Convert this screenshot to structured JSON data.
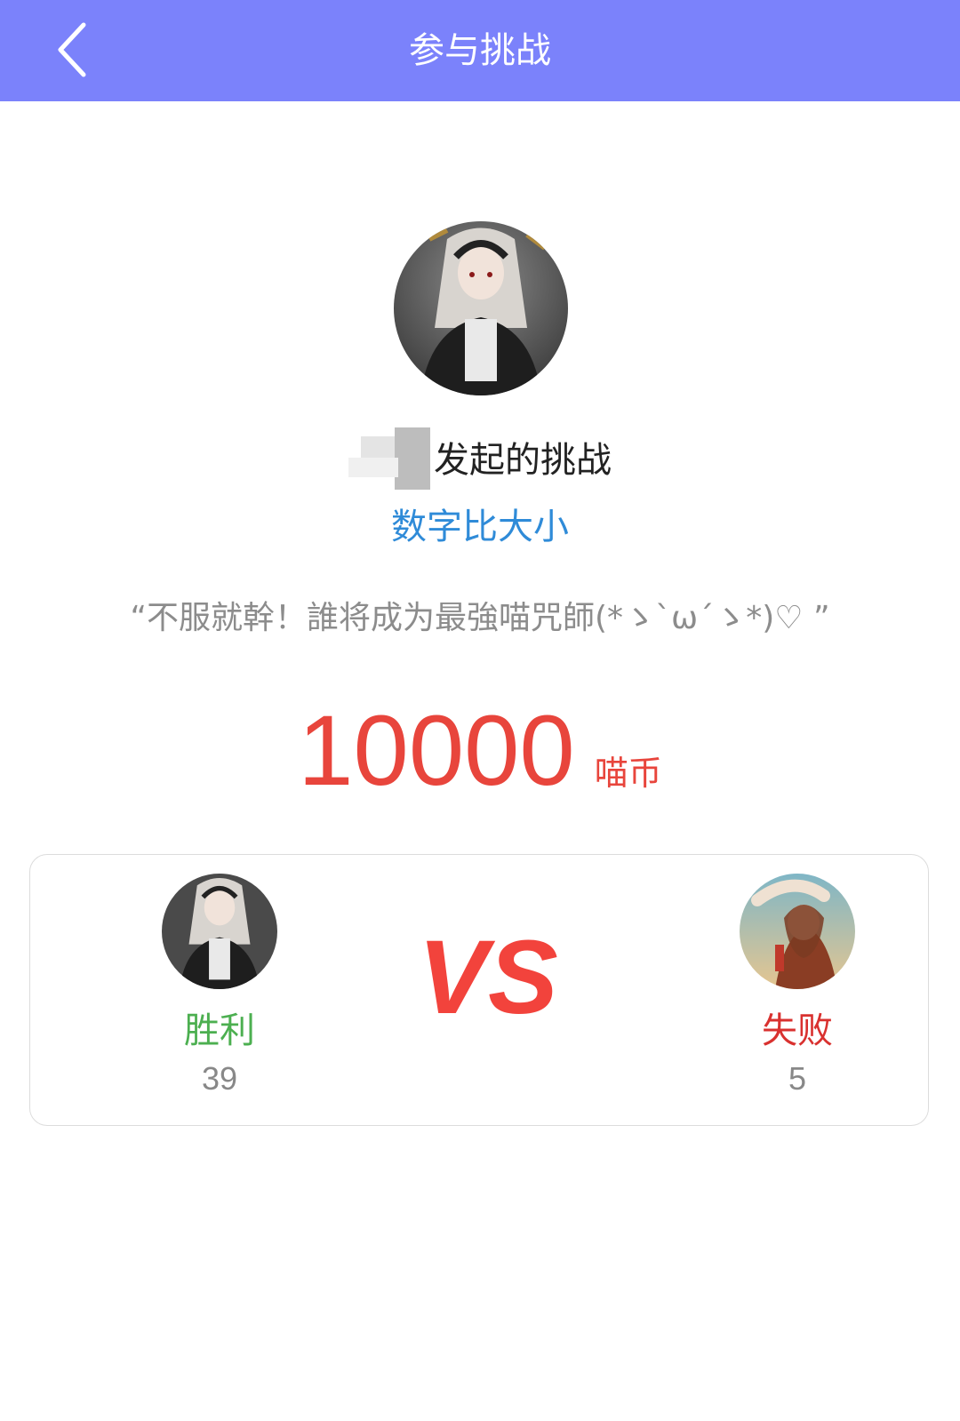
{
  "header": {
    "title": "参与挑战",
    "back_icon": "chevron-left-icon"
  },
  "challenge": {
    "initiator_suffix": "发起的挑战",
    "game_type": "数字比大小",
    "slogan": "“不服就幹！誰将成为最強喵咒師(*ゝ`ω´ゝ*)♡ ”",
    "stake_amount": "10000",
    "stake_unit": "喵币"
  },
  "match": {
    "vs_text": "VS",
    "left": {
      "result": "胜利",
      "count": "39"
    },
    "right": {
      "result": "失败",
      "count": "5"
    }
  },
  "colors": {
    "topbar": "#7b82fb",
    "game_type": "#2f8bd8",
    "stake": "#e8453c",
    "win": "#4caf50",
    "lose": "#d9312f",
    "vs": "#f2433c"
  }
}
